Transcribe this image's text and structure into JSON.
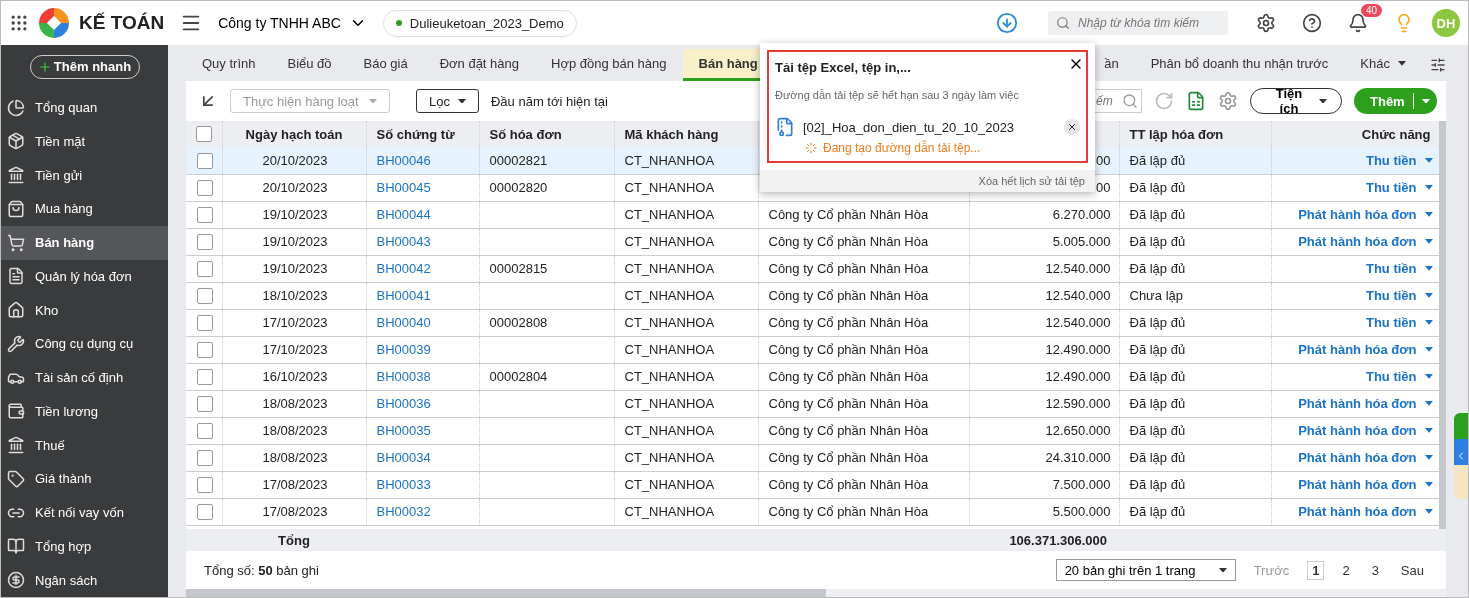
{
  "app": {
    "name": "KẾ TOÁN",
    "company": "Công ty TNHH ABC",
    "database": "Dulieuketoan_2023_Demo",
    "search_placeholder": "Nhập từ khóa tìm kiếm",
    "notification_count": "40",
    "avatar": "DH"
  },
  "sidebar": {
    "quick_add": "Thêm nhanh",
    "items": [
      {
        "label": "Tổng quan",
        "selected": false
      },
      {
        "label": "Tiền mặt",
        "selected": false
      },
      {
        "label": "Tiền gửi",
        "selected": false
      },
      {
        "label": "Mua hàng",
        "selected": false
      },
      {
        "label": "Bán hàng",
        "selected": true
      },
      {
        "label": "Quản lý hóa đơn",
        "selected": false
      },
      {
        "label": "Kho",
        "selected": false
      },
      {
        "label": "Công cụ dụng cụ",
        "selected": false
      },
      {
        "label": "Tài sản cố định",
        "selected": false
      },
      {
        "label": "Tiền lương",
        "selected": false
      },
      {
        "label": "Thuế",
        "selected": false
      },
      {
        "label": "Giá thành",
        "selected": false
      },
      {
        "label": "Kết nối vay vốn",
        "selected": false
      },
      {
        "label": "Tổng hợp",
        "selected": false
      },
      {
        "label": "Ngân sách",
        "selected": false
      }
    ]
  },
  "tabs": [
    {
      "label": "Quy trình",
      "selected": false
    },
    {
      "label": "Biểu đồ",
      "selected": false
    },
    {
      "label": "Báo giá",
      "selected": false
    },
    {
      "label": "Đơn đặt hàng",
      "selected": false
    },
    {
      "label": "Hợp đồng bán hàng",
      "selected": false
    },
    {
      "label": "Bán hàng",
      "selected": true
    },
    {
      "label": "ần",
      "selected": false
    },
    {
      "label": "Phân bổ doanh thu nhận trước",
      "selected": false
    }
  ],
  "more_tab": "Khác",
  "toolbar": {
    "batch": "Thực hiện hàng loạt",
    "filter": "Lọc",
    "period": "Đầu năm tới hiện tại",
    "search_placeholder": "ếm",
    "utilities": "Tiện ích",
    "add": "Thêm"
  },
  "table": {
    "select_all_checked": false,
    "columns": [
      "Ngày hạch toán",
      "Số chứng từ",
      "Số hóa đơn",
      "Mã khách hàng",
      "",
      "",
      "TT lập hóa đơn",
      "Chức năng"
    ],
    "rows": [
      {
        "date": "20/10/2023",
        "voucher": "BH00046",
        "invoice": "00002821",
        "customer_code": "CT_NHANHOA",
        "column_7": "00",
        "status": "Đã lập đủ",
        "action": "Thu tiền",
        "checked": false,
        "hovered": true
      },
      {
        "date": "20/10/2023",
        "voucher": "BH00045",
        "invoice": "00002820",
        "customer_code": "CT_NHANHOA",
        "column_7": "00",
        "status": "Đã lập đủ",
        "action": "Thu tiền",
        "checked": false,
        "hovered": false
      },
      {
        "date": "19/10/2023",
        "voucher": "BH00044",
        "customer_code": "CT_NHANHOA",
        "column_6": "Công ty Cổ phần Nhân Hòa",
        "column_7": "6.270.000",
        "status": "Đã lập đủ",
        "action": "Phát hành hóa đơn",
        "checked": false,
        "hovered": false
      },
      {
        "date": "19/10/2023",
        "voucher": "BH00043",
        "customer_code": "CT_NHANHOA",
        "column_6": "Công ty Cổ phần Nhân Hòa",
        "column_7": "5.005.000",
        "status": "Đã lập đủ",
        "action": "Phát hành hóa đơn",
        "checked": false,
        "hovered": false
      },
      {
        "date": "19/10/2023",
        "voucher": "BH00042",
        "invoice": "00002815",
        "customer_code": "CT_NHANHOA",
        "column_6": "Công ty Cổ phần Nhân Hòa",
        "column_7": "12.540.000",
        "status": "Đã lập đủ",
        "action": "Thu tiền",
        "checked": false,
        "hovered": false
      },
      {
        "date": "18/10/2023",
        "voucher": "BH00041",
        "customer_code": "CT_NHANHOA",
        "column_6": "Công ty Cổ phần Nhân Hòa",
        "column_7": "12.540.000",
        "status": "Chưa lập",
        "action": "Thu tiền",
        "checked": false,
        "hovered": false
      },
      {
        "date": "17/10/2023",
        "voucher": "BH00040",
        "invoice": "00002808",
        "customer_code": "CT_NHANHOA",
        "column_6": "Công ty Cổ phần Nhân Hòa",
        "column_7": "12.540.000",
        "status": "Đã lập đủ",
        "action": "Thu tiền",
        "checked": false,
        "hovered": false
      },
      {
        "date": "17/10/2023",
        "voucher": "BH00039",
        "customer_code": "CT_NHANHOA",
        "column_6": "Công ty Cổ phần Nhân Hòa",
        "column_7": "12.490.000",
        "status": "Đã lập đủ",
        "action": "Phát hành hóa đơn",
        "checked": false,
        "hovered": false
      },
      {
        "date": "16/10/2023",
        "voucher": "BH00038",
        "invoice": "00002804",
        "customer_code": "CT_NHANHOA",
        "column_6": "Công ty Cổ phần Nhân Hòa",
        "column_7": "12.490.000",
        "status": "Đã lập đủ",
        "action": "Thu tiền",
        "checked": false,
        "hovered": false
      },
      {
        "date": "18/08/2023",
        "voucher": "BH00036",
        "customer_code": "CT_NHANHOA",
        "column_6": "Công ty Cổ phần Nhân Hòa",
        "column_7": "12.590.000",
        "status": "Đã lập đủ",
        "action": "Phát hành hóa đơn",
        "checked": false,
        "hovered": false
      },
      {
        "date": "18/08/2023",
        "voucher": "BH00035",
        "customer_code": "CT_NHANHOA",
        "column_6": "Công ty Cổ phần Nhân Hòa",
        "column_7": "12.650.000",
        "status": "Đã lập đủ",
        "action": "Phát hành hóa đơn",
        "checked": false,
        "hovered": false
      },
      {
        "date": "18/08/2023",
        "voucher": "BH00034",
        "customer_code": "CT_NHANHOA",
        "column_6": "Công ty Cổ phần Nhân Hòa",
        "column_7": "24.310.000",
        "status": "Đã lập đủ",
        "action": "Phát hành hóa đơn",
        "checked": false,
        "hovered": false
      },
      {
        "date": "17/08/2023",
        "voucher": "BH00033",
        "customer_code": "CT_NHANHOA",
        "column_6": "Công ty Cổ phần Nhân Hòa",
        "column_7": "7.500.000",
        "status": "Đã lập đủ",
        "action": "Phát hành hóa đơn",
        "checked": false,
        "hovered": false
      },
      {
        "date": "17/08/2023",
        "voucher": "BH00032",
        "customer_code": "CT_NHANHOA",
        "column_6": "Công ty Cổ phần Nhân Hòa",
        "column_7": "5.500.000",
        "status": "Đã lập đủ",
        "action": "Phát hành hóa đơn",
        "checked": false,
        "hovered": false
      }
    ],
    "total_label": "Tổng",
    "total_amount": "106.371.306.000"
  },
  "footer": {
    "record_count": "Tổng số: **50** bản ghi",
    "page_size": "20 bản ghi trên 1 trang",
    "prev": "Trước",
    "pages": [
      {
        "label": "1",
        "selected": true
      },
      {
        "label": "2",
        "selected": false
      },
      {
        "label": "3",
        "selected": false
      }
    ],
    "next": "Sau"
  },
  "download_popup": {
    "title": "Tải tệp Excel, tệp in,...",
    "note": "Đường dẫn tải tệp sẽ hết hạn sau 3 ngày làm việc",
    "file": "[02]_Hoa_don_dien_tu_20_10_2023",
    "progress": "Đang tạo đường dẫn tải tệp...",
    "clear": "Xóa hết lịch sử tải tệp"
  }
}
